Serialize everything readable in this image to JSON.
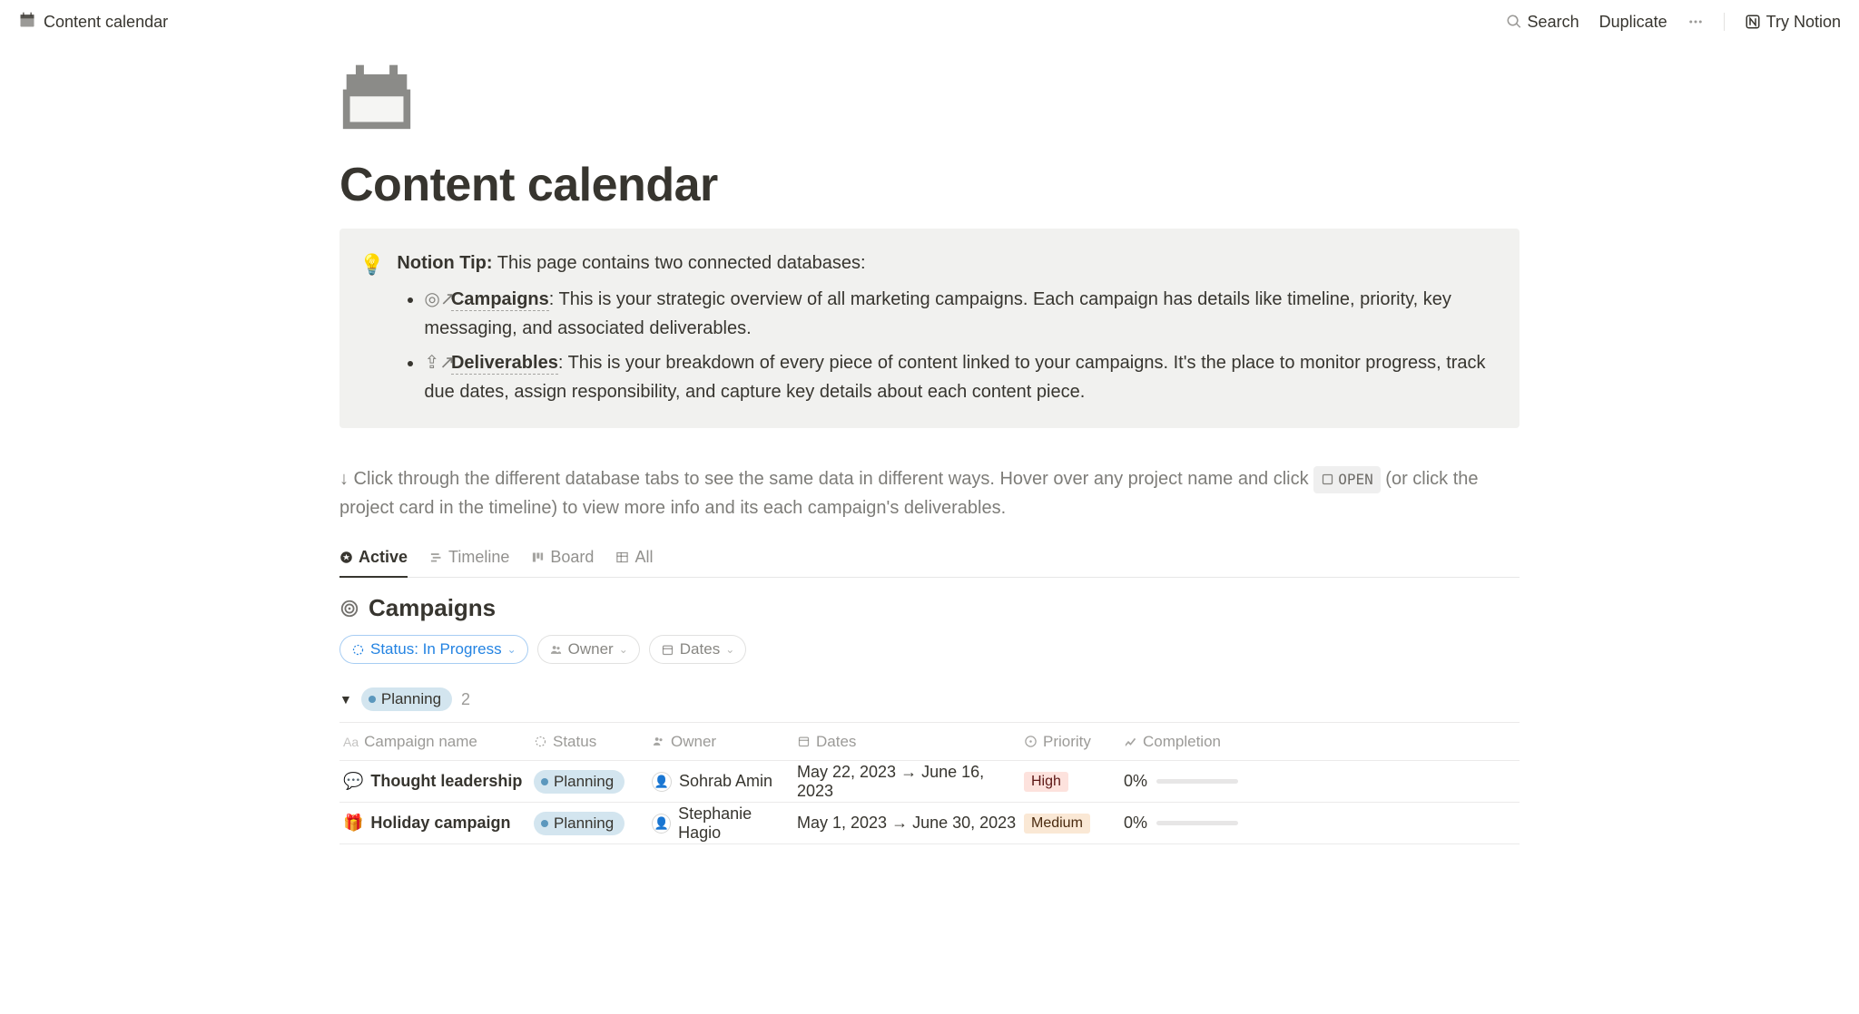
{
  "breadcrumb": {
    "title": "Content calendar"
  },
  "topbar": {
    "search": "Search",
    "duplicate": "Duplicate",
    "try_notion": "Try Notion"
  },
  "page": {
    "title": "Content calendar"
  },
  "callout": {
    "tip_label": "Notion Tip:",
    "tip_text": " This page contains two connected databases:",
    "items": [
      {
        "title": "Campaigns",
        "text": ": This is your strategic overview of all marketing campaigns. Each campaign has details like timeline, priority, key messaging, and associated deliverables."
      },
      {
        "title": "Deliverables",
        "text": ": This is your breakdown of every piece of content linked to your campaigns. It's the place to monitor progress, track due dates, assign responsibility, and capture key details about each content piece."
      }
    ]
  },
  "instructions": {
    "pre": "↓ Click through the different database tabs to see the same data in different ways. Hover over any project name and click ",
    "open_label": "OPEN",
    "post": " (or click the project card in the timeline) to view more info and its each campaign's deliverables."
  },
  "tabs": [
    {
      "label": "Active",
      "active": true
    },
    {
      "label": "Timeline"
    },
    {
      "label": "Board"
    },
    {
      "label": "All"
    }
  ],
  "database": {
    "title": "Campaigns"
  },
  "filters": {
    "status": {
      "label": "Status: In Progress"
    },
    "owner": {
      "label": "Owner"
    },
    "dates": {
      "label": "Dates"
    }
  },
  "group": {
    "label": "Planning",
    "count": "2"
  },
  "columns": {
    "name": "Campaign name",
    "status": "Status",
    "owner": "Owner",
    "dates": "Dates",
    "priority": "Priority",
    "completion": "Completion"
  },
  "rows": [
    {
      "icon": "💬",
      "name": "Thought leadership",
      "status": "Planning",
      "owner": "Sohrab Amin",
      "dates": "May 22, 2023 → June 16, 2023",
      "priority": "High",
      "priority_class": "priority-high",
      "completion": "0%"
    },
    {
      "icon": "🎁",
      "name": "Holiday campaign",
      "status": "Planning",
      "owner": "Stephanie Hagio",
      "dates": "May 1, 2023 → June 30, 2023",
      "priority": "Medium",
      "priority_class": "priority-medium",
      "completion": "0%"
    }
  ]
}
